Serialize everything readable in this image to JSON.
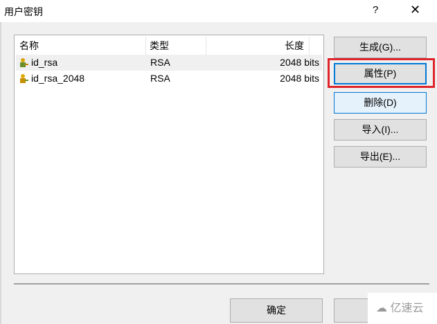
{
  "window": {
    "title": "用户密钥",
    "help": "?",
    "close": "✕"
  },
  "table": {
    "headers": [
      "名称",
      "类型",
      "长度"
    ],
    "rows": [
      {
        "name": "id_rsa",
        "type": "RSA",
        "length": "2048 bits"
      },
      {
        "name": "id_rsa_2048",
        "type": "RSA",
        "length": "2048 bits"
      }
    ]
  },
  "buttons": {
    "generate": "生成(G)...",
    "properties": "属性(P)",
    "delete": "删除(D)",
    "import": "导入(I)...",
    "export": "导出(E)...",
    "ok": "确定"
  },
  "watermark": "亿速云",
  "colors": {
    "highlight": "#e0242b",
    "focus": "#0078d7"
  }
}
